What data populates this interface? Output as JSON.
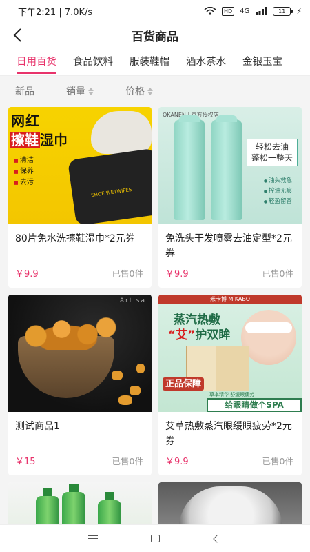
{
  "status_bar": {
    "time": "下午2:21 | 7.0K/s",
    "hd": "HD",
    "network": "4G",
    "battery": "11"
  },
  "header": {
    "title": "百货商品"
  },
  "category_tabs": [
    {
      "label": "日用百货",
      "active": true
    },
    {
      "label": "食品饮料",
      "active": false
    },
    {
      "label": "服装鞋帽",
      "active": false
    },
    {
      "label": "酒水茶水",
      "active": false
    },
    {
      "label": "金银玉宝",
      "active": false
    }
  ],
  "sort_options": [
    {
      "label": "新品"
    },
    {
      "label": "销量"
    },
    {
      "label": "价格"
    }
  ],
  "products": [
    {
      "name": "80片免水洗擦鞋湿巾*2元券",
      "price": "￥9.9",
      "sold": "已售0件",
      "image": {
        "headline1": "网红",
        "headline2_red": "擦鞋",
        "headline2_rest": "湿巾",
        "tags": [
          "清洁",
          "保养",
          "去污"
        ],
        "pack_label": "SHOE WETWIPES"
      }
    },
    {
      "name": "免洗头干发喷雾去油定型*2元券",
      "price": "￥9.9",
      "sold": "已售0件",
      "image": {
        "brand": "OKANEN | 官方授权店",
        "slogan_line1": "轻松去油",
        "slogan_line2": "蓬松一整天",
        "bullets": [
          "油头救急",
          "控油无痕",
          "轻盈留香"
        ]
      }
    },
    {
      "name": "测试商品1",
      "price": "￥15",
      "sold": "已售0件",
      "image": {
        "caption": "Artisa"
      }
    },
    {
      "name": "艾草热敷蒸汽眼缓眼疲劳*2元券",
      "price": "￥9.9",
      "sold": "已售0件",
      "image": {
        "brand_bar": "米卡博 MIKABO",
        "line1": "蒸汽热敷",
        "line2_quote": "“艾”",
        "line2_rest": "护双眸",
        "seal": "正品保障",
        "sub": "草本精华 舒缓眼疲劳",
        "banner": "给眼睛做个SPA"
      }
    },
    {
      "name": "",
      "price": "",
      "sold": ""
    },
    {
      "name": "",
      "price": "",
      "sold": ""
    }
  ],
  "colors": {
    "accent": "#e8336b"
  }
}
